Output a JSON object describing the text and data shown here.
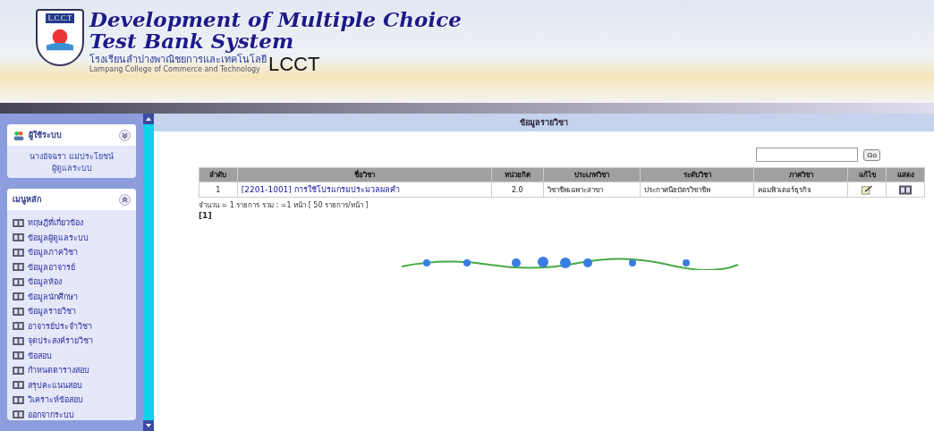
{
  "header": {
    "logo_text": "L.C.C.T",
    "title_line1": "Development of Multiple Choice",
    "title_line2": "Test Bank System",
    "school_thai": "โรงเรียนลำปางพาณิชยการและเทคโนโลยี",
    "school_english": "Lampang College of Commerce and Technology",
    "abbr": "LCCT"
  },
  "sidebar": {
    "user_panel": {
      "title": "ผู้ใช้ระบบ",
      "expanded": false,
      "name": "นางอัจฉรา แม่ประโยชน์",
      "role": "ผู้ดูแลระบบ"
    },
    "menu_panel": {
      "title": "เมนูหลัก",
      "expanded": true,
      "items": [
        "ทฤษฎีที่เกี่ยวข้อง",
        "ข้อมูลผู้ดูแลระบบ",
        "ข้อมูลภาควิชา",
        "ข้อมูลอาจารย์",
        "ข้อมูลห้อง",
        "ข้อมูลนักศึกษา",
        "ข้อมูลรายวิชา",
        "อาจารย์ประจำวิชา",
        "จุดประสงค์รายวิชา",
        "ข้อสอบ",
        "กำหนดตารางสอบ",
        "สรุปคะแนนสอบ",
        "วิเคราะห์ข้อสอบ",
        "ออกจากระบบ"
      ]
    }
  },
  "main": {
    "title": "ข้อมูลรายวิชา",
    "search": {
      "button": "Go"
    },
    "table": {
      "columns": [
        "ลำดับ",
        "ชื่อวิชา",
        "หน่วยกิต",
        "ประเภทวิชา",
        "ระดับวิชา",
        "ภาควิชา",
        "แก้ไข",
        "แสดง"
      ],
      "rows": [
        {
          "no": "1",
          "name": "[2201-1001] การใช้โปรแกรมประมวลผลคำ",
          "credits": "2.0",
          "type": "วิชาชีพเฉพาะสาขา",
          "level": "ประกาศนียบัตรวิชาชีพ",
          "department": "คอมพิวเตอร์ธุรกิจ"
        }
      ]
    },
    "summary": "จำนวน = 1 รายการ รวม : =1 หน้า [ 50 รายการ/หน้า ]",
    "pages": "[1]"
  }
}
